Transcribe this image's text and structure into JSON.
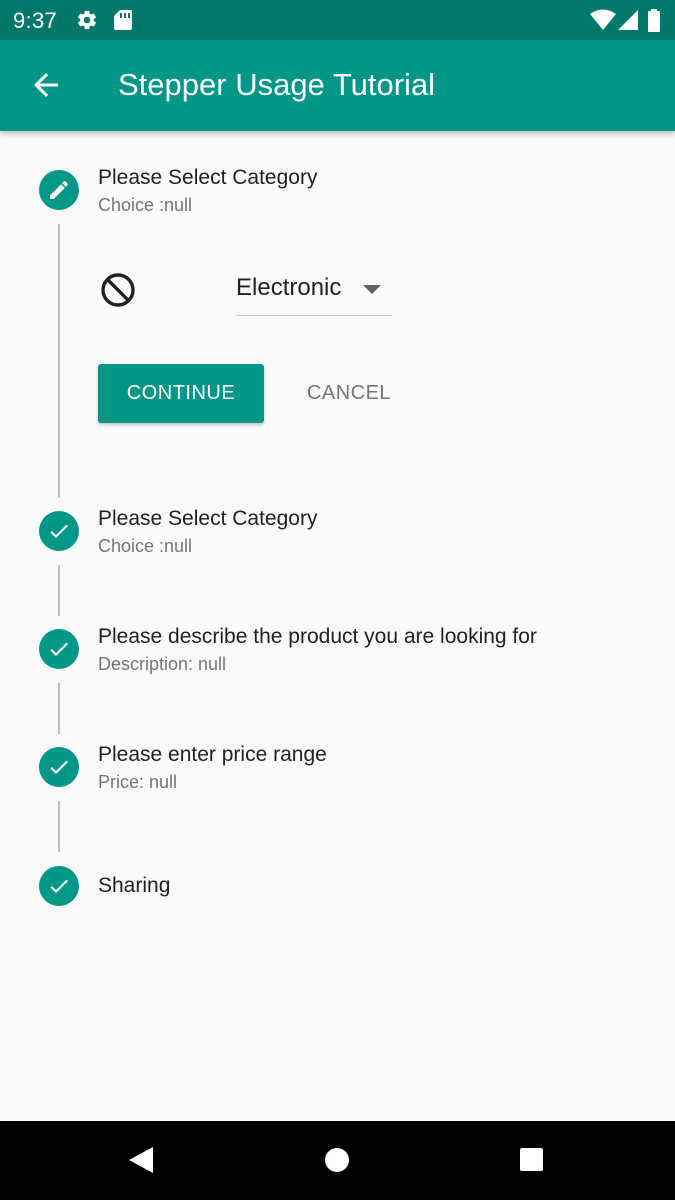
{
  "status_bar": {
    "time": "9:37",
    "icons": [
      "gear-icon",
      "sd-card-icon",
      "wifi-icon",
      "cell-signal-icon",
      "battery-icon"
    ]
  },
  "app_bar": {
    "title": "Stepper Usage Tutorial",
    "back_icon": "arrow-back-icon"
  },
  "colors": {
    "primary": "#009688",
    "primary_dark": "#00796b",
    "connector": "#bdbdbd",
    "subtitle": "#757575",
    "background": "#fafafa"
  },
  "steps": [
    {
      "title": "Please Select Category",
      "subtitle": "Choice :null",
      "icon": "edit-icon",
      "state": "editing"
    },
    {
      "title": "Please Select Category",
      "subtitle": "Choice :null",
      "icon": "check-icon",
      "state": "complete"
    },
    {
      "title": "Please describe the product you are looking for",
      "subtitle": "Description: null",
      "icon": "check-icon",
      "state": "complete"
    },
    {
      "title": "Please enter price range",
      "subtitle": "Price: null",
      "icon": "check-icon",
      "state": "complete"
    },
    {
      "title": "Sharing",
      "icon": "check-icon",
      "state": "complete"
    }
  ],
  "step_content": {
    "dropdown_value": "Electronic",
    "continue_label": "CONTINUE",
    "cancel_label": "CANCEL"
  },
  "nav_bar": {
    "buttons": [
      "back-triangle-icon",
      "home-circle-icon",
      "recents-square-icon"
    ]
  }
}
